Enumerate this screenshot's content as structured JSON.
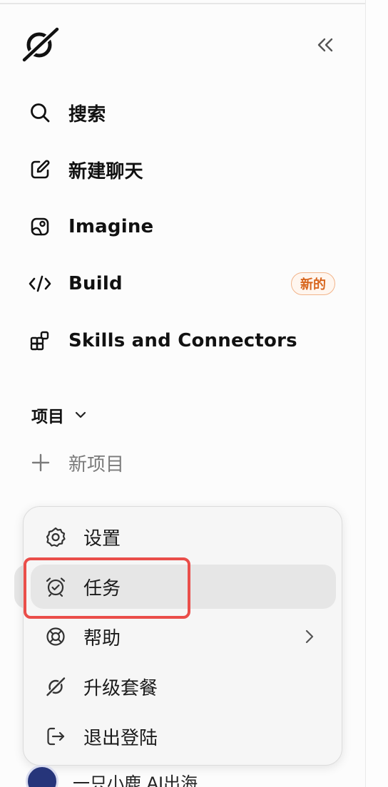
{
  "sidebar": {
    "nav": [
      {
        "label": "搜索",
        "icon": "search-icon"
      },
      {
        "label": "新建聊天",
        "icon": "edit-icon"
      },
      {
        "label": "Imagine",
        "icon": "image-icon"
      },
      {
        "label": "Build",
        "icon": "code-icon",
        "badge": "新的"
      },
      {
        "label": "Skills and Connectors",
        "icon": "grid-plus-icon"
      }
    ],
    "projects_label": "项目",
    "new_project_label": "新项目",
    "collapse_icon": "double-chevron-left-icon",
    "logo_icon": "logo-icon"
  },
  "menu": {
    "items": [
      {
        "label": "设置",
        "icon": "gear-icon"
      },
      {
        "label": "任务",
        "icon": "alarm-clock-icon"
      },
      {
        "label": "帮助",
        "icon": "lifebuoy-icon"
      },
      {
        "label": "升级套餐",
        "icon": "logo-icon"
      },
      {
        "label": "退出登陆",
        "icon": "logout-icon"
      }
    ],
    "active_index": 1
  },
  "user": {
    "name": "一只小鹿 AI出海"
  },
  "colors": {
    "badge_text": "#d8661e",
    "badge_border": "#f2b48a",
    "highlight": "#ea4e4a",
    "active_bg": "#e6e6e6"
  }
}
